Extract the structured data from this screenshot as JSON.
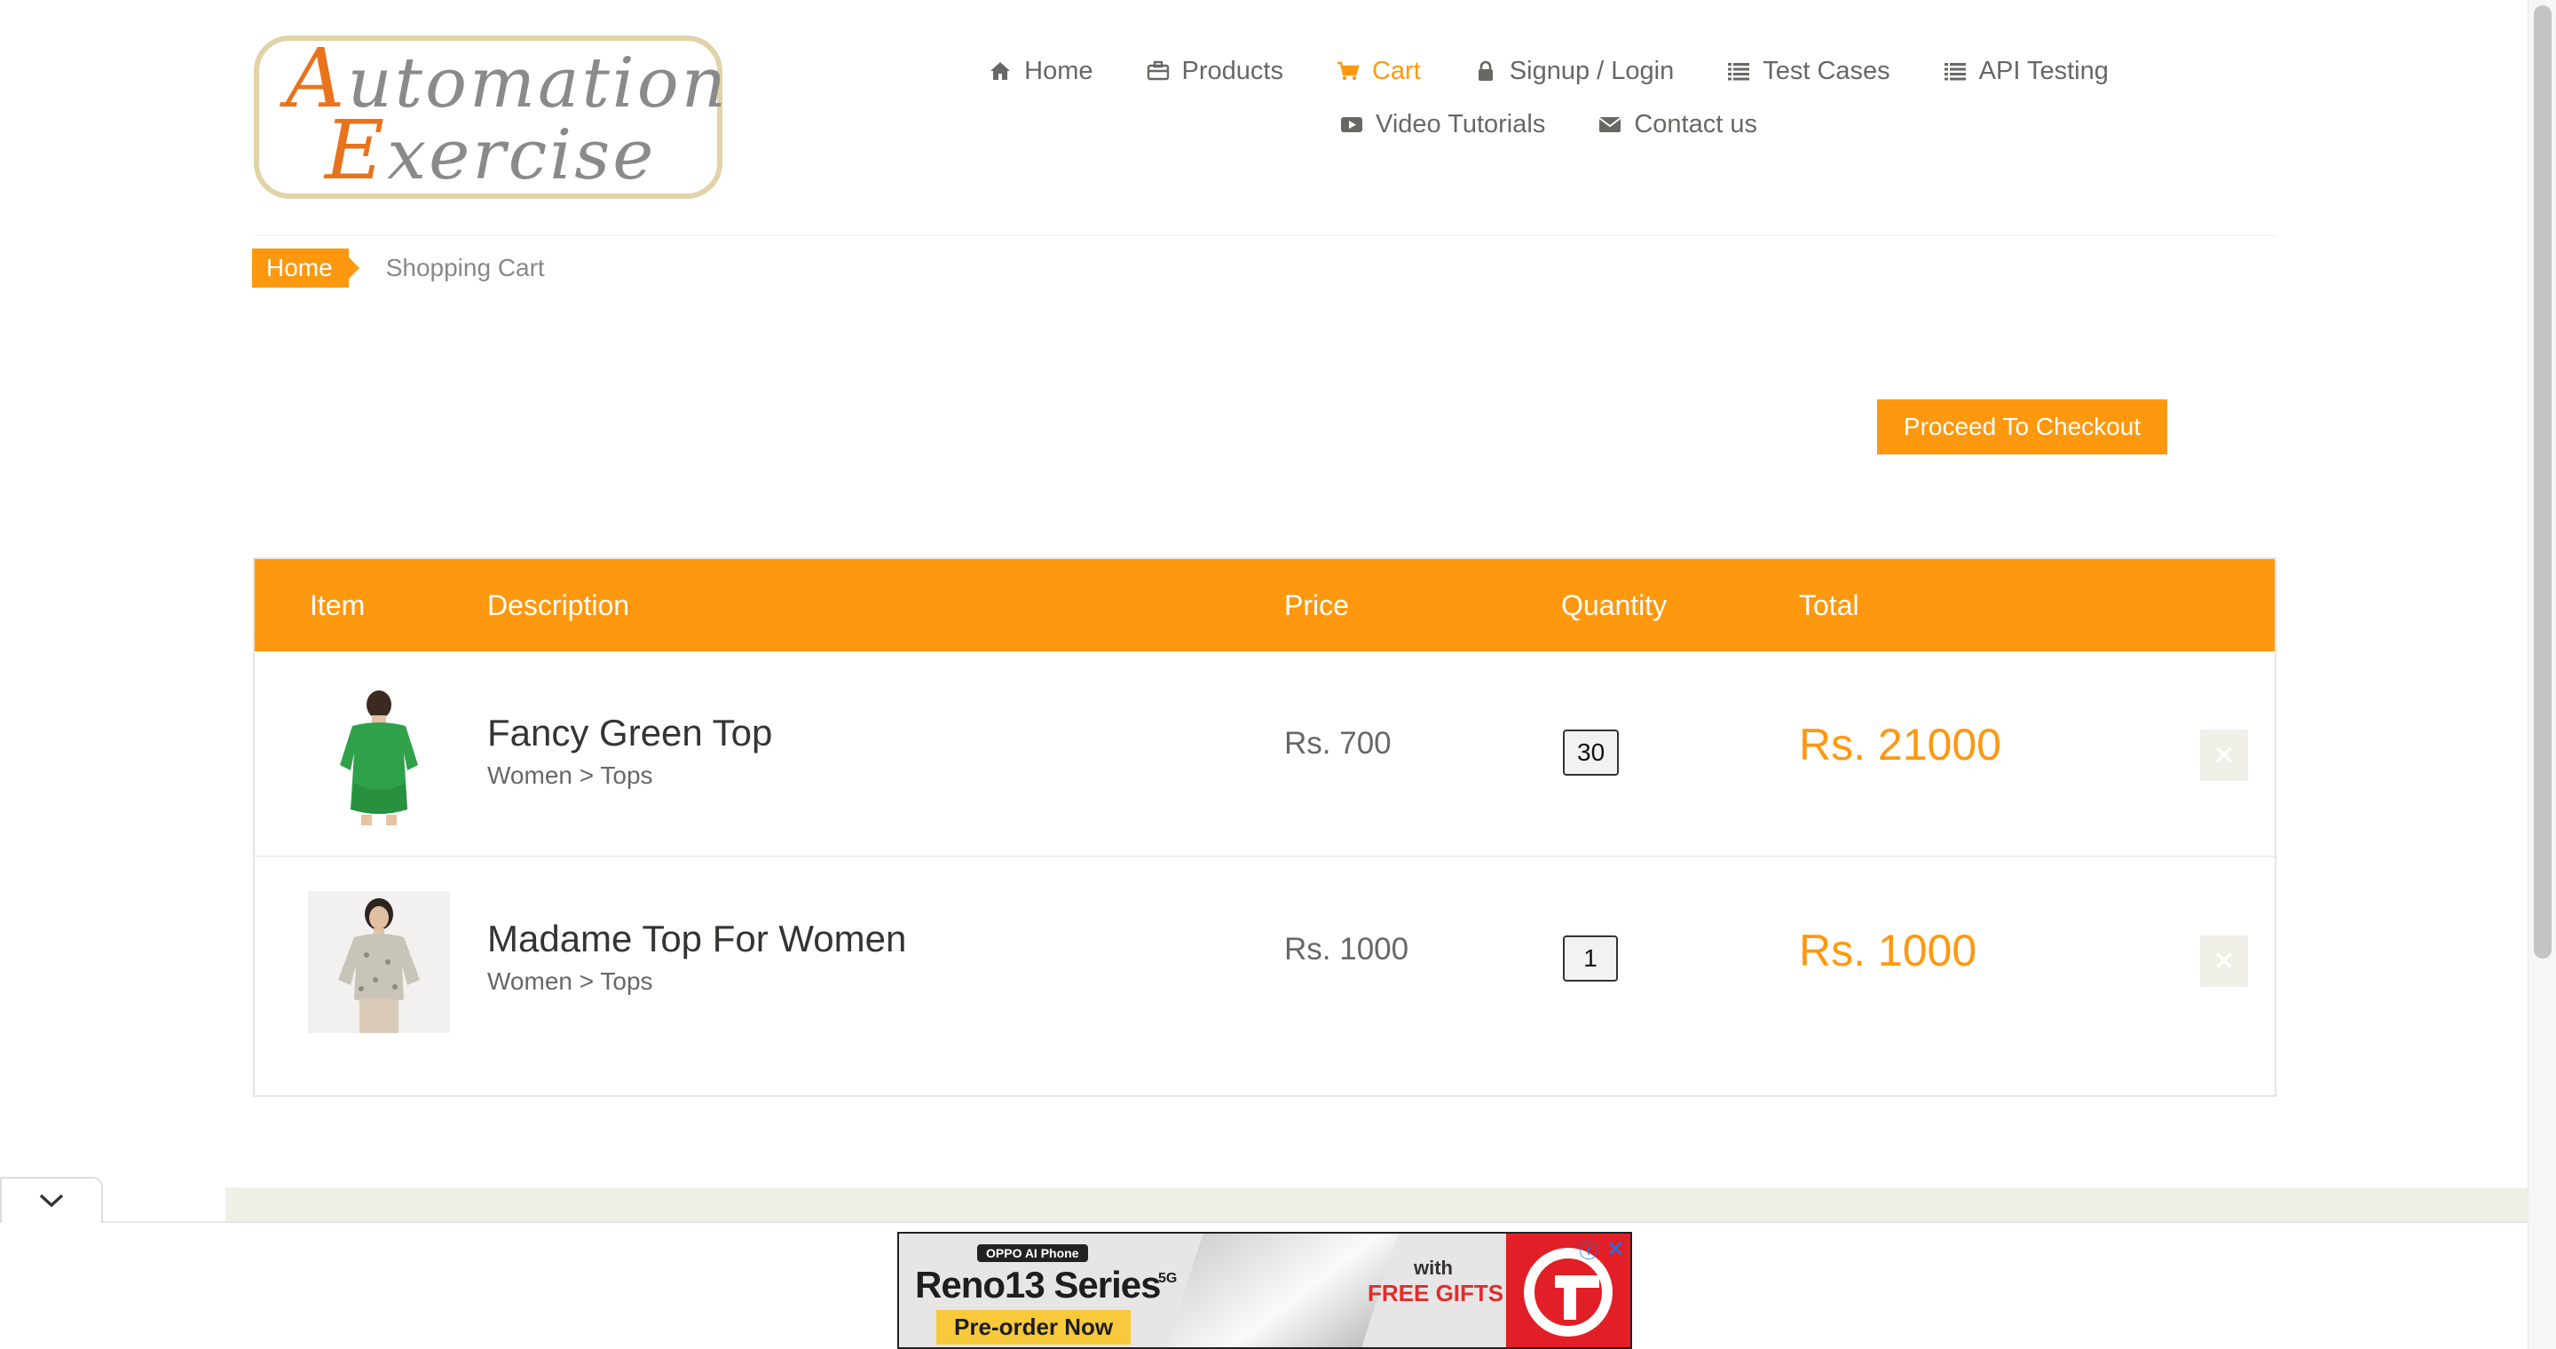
{
  "logo": {
    "line1": "Automation",
    "line2": "Exercise"
  },
  "nav": {
    "row1": [
      {
        "label": "Home",
        "icon": "home-icon"
      },
      {
        "label": "Products",
        "icon": "briefcase-icon"
      },
      {
        "label": "Cart",
        "icon": "shopping-cart-icon",
        "active": true
      },
      {
        "label": "Signup / Login",
        "icon": "lock-icon"
      },
      {
        "label": "Test Cases",
        "icon": "list-icon"
      },
      {
        "label": "API Testing",
        "icon": "list-icon"
      }
    ],
    "row2": [
      {
        "label": "Video Tutorials",
        "icon": "youtube-play-icon"
      },
      {
        "label": "Contact us",
        "icon": "envelope-icon"
      }
    ]
  },
  "breadcrumb": {
    "home": "Home",
    "current": "Shopping Cart"
  },
  "checkout": {
    "label": "Proceed To Checkout"
  },
  "cart": {
    "headers": {
      "item": "Item",
      "description": "Description",
      "price": "Price",
      "quantity": "Quantity",
      "total": "Total"
    },
    "rows": [
      {
        "name": "Fancy Green Top",
        "category": "Women > Tops",
        "price": "Rs. 700",
        "quantity": "30",
        "total": "Rs. 21000",
        "thumb": "green-top-image"
      },
      {
        "name": "Madame Top For Women",
        "category": "Women > Tops",
        "price": "Rs. 1000",
        "quantity": "1",
        "total": "Rs. 1000",
        "thumb": "floral-top-image"
      }
    ]
  },
  "ad": {
    "brand": "OPPO AI Phone",
    "title": "Reno13 Series",
    "badge": "5G",
    "cta": "Pre-order Now",
    "with": "with",
    "gifts": "FREE GIFTS"
  },
  "colors": {
    "accent": "#fe980f",
    "text": "#696763",
    "rule": "#f0f0e9"
  }
}
